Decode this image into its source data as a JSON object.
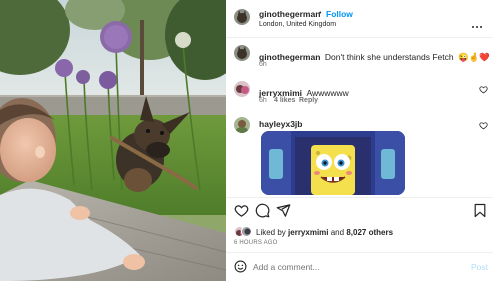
{
  "header": {
    "username": "ginothegerman",
    "separator": "•",
    "follow_label": "Follow",
    "location": "London, United Kingdom",
    "more_icon": "more-horizontal-icon"
  },
  "caption": {
    "username": "ginothegerman",
    "text": "Don't think she understands Fetch",
    "emojis": [
      "😜",
      "🤞",
      "❤️"
    ],
    "time": "6h"
  },
  "comments": [
    {
      "username": "jerryxmimi",
      "text": "Awwwwww",
      "time": "6h",
      "likes": "4 likes",
      "reply_label": "Reply"
    },
    {
      "username": "hayleyx3jb",
      "text": "",
      "attachment": "gif-spongebob"
    }
  ],
  "actions": {
    "like_icon": "heart-icon",
    "comment_icon": "comment-icon",
    "share_icon": "send-icon",
    "save_icon": "bookmark-icon"
  },
  "likes": {
    "prefix": "Liked by",
    "user": "jerryxmimi",
    "conjunction": "and",
    "others": "8,027 others"
  },
  "timestamp": "6 HOURS AGO",
  "add_comment": {
    "placeholder": "Add a comment...",
    "post_label": "Post",
    "emoji_icon": "smiley-icon"
  },
  "colors": {
    "accent": "#0095f6",
    "text": "#262626",
    "muted": "#737373",
    "like_red": "#ed4956"
  }
}
